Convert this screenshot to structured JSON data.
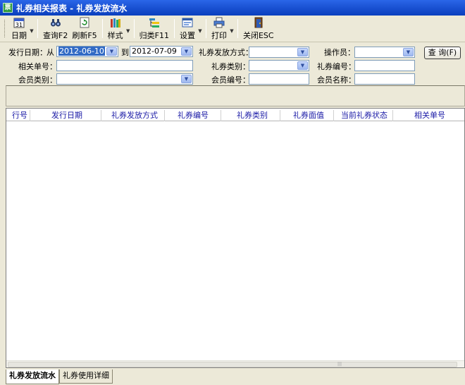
{
  "window": {
    "title": "礼券相关报表 - 礼券发放流水",
    "icon": "app-icon"
  },
  "toolbar": {
    "date": {
      "label": "日期",
      "icon": "calendar-icon",
      "icon_text": "31"
    },
    "query": {
      "label": "查询F2",
      "icon": "binoculars-icon"
    },
    "refresh": {
      "label": "刷新F5",
      "icon": "refresh-icon"
    },
    "style": {
      "label": "样式",
      "icon": "books-icon"
    },
    "group": {
      "label": "归类F11",
      "icon": "group-icon"
    },
    "settings": {
      "label": "设置",
      "icon": "settings-icon"
    },
    "print": {
      "label": "打印",
      "icon": "printer-icon"
    },
    "close": {
      "label": "关闭ESC",
      "icon": "door-exit-icon"
    }
  },
  "filters": {
    "issue_date_label": "发行日期：",
    "from_label": "从",
    "from_date": "2012-06-10",
    "to_label": "到",
    "to_date": "2012-07-09",
    "issue_method_label": "礼券发放方式：",
    "issue_method_value": "",
    "operator_label": "操作员：",
    "operator_value": "",
    "related_no_label": "相关单号：",
    "related_no_value": "",
    "coupon_type_label": "礼券类别：",
    "coupon_type_value": "",
    "coupon_no_label": "礼券编号：",
    "coupon_no_value": "",
    "member_type_label": "会员类别：",
    "member_type_value": "",
    "member_no_label": "会员编号：",
    "member_no_value": "",
    "member_name_label": "会员名称：",
    "member_name_value": "",
    "query_button": "查 询(F)"
  },
  "grid": {
    "columns": [
      "行号",
      "发行日期",
      "礼券发放方式",
      "礼券编号",
      "礼券类别",
      "礼券面值",
      "当前礼券状态",
      "相关单号"
    ],
    "rows": []
  },
  "tabs": [
    {
      "label": "礼券发放流水",
      "active": true
    },
    {
      "label": "礼券使用详细",
      "active": false
    }
  ]
}
